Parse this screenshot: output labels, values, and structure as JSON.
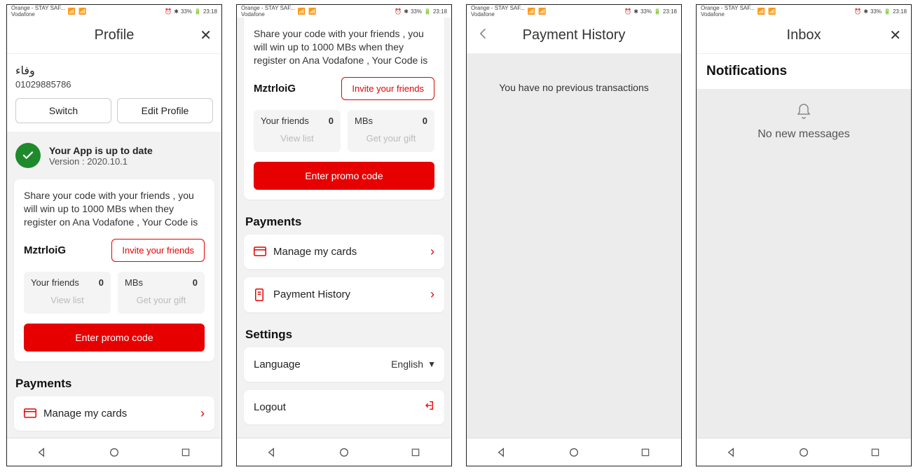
{
  "statusbar": {
    "carrier_top": "Orange - STAY SAF...",
    "carrier_bottom": "Vodafone",
    "battery_pct": "33%",
    "time": "23:18"
  },
  "screens": {
    "profile": {
      "header_title": "Profile",
      "close_glyph": "✕",
      "user_name": "وفاء",
      "user_phone": "01029885786",
      "switch_btn": "Switch",
      "edit_btn": "Edit Profile",
      "uptodate_title": "Your App is up to date",
      "uptodate_version": "Version : 2020.10.1",
      "share_desc": "Share your code with your friends , you will win up to 1000 MBs when they register on Ana Vodafone , Your Code is",
      "referral_code": "MztrloiG",
      "invite_btn": "Invite your friends",
      "friends_label": "Your friends",
      "friends_count": "0",
      "friends_action": "View list",
      "mbs_label": "MBs",
      "mbs_count": "0",
      "mbs_action": "Get your gift",
      "promo_btn": "Enter promo code",
      "payments_title": "Payments",
      "manage_cards": "Manage my cards"
    },
    "profile2": {
      "share_desc": "Share your code with your friends , you will win up to 1000 MBs when they register on Ana Vodafone , Your Code is",
      "referral_code": "MztrloiG",
      "invite_btn": "Invite your friends",
      "friends_label": "Your friends",
      "friends_count": "0",
      "friends_action": "View list",
      "mbs_label": "MBs",
      "mbs_count": "0",
      "mbs_action": "Get your gift",
      "promo_btn": "Enter promo code",
      "payments_title": "Payments",
      "manage_cards": "Manage my cards",
      "payment_history": "Payment History",
      "settings_title": "Settings",
      "language_label": "Language",
      "language_value": "English",
      "logout": "Logout"
    },
    "history": {
      "header_title": "Payment History",
      "empty_msg": "You have no previous transactions"
    },
    "inbox": {
      "header_title": "Inbox",
      "close_glyph": "✕",
      "notifications_title": "Notifications",
      "no_messages": "No new messages"
    }
  }
}
